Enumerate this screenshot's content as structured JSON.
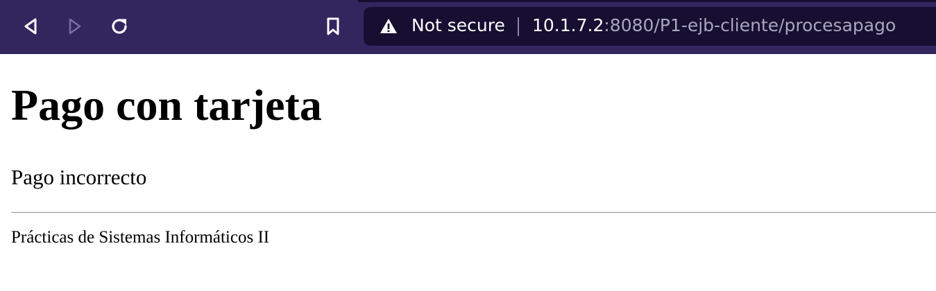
{
  "toolbar": {
    "back_icon": "back-arrow-icon",
    "forward_icon": "forward-arrow-icon",
    "reload_icon": "reload-icon",
    "bookmark_icon": "bookmark-icon",
    "background_color": "#33255e"
  },
  "omnibox": {
    "security_icon": "warning-triangle-icon",
    "security_label": "Not secure",
    "url_host": "10.1.7.2",
    "url_rest": ":8080/P1-ejb-cliente/procesapago",
    "background_color": "#160f32"
  },
  "page": {
    "title": "Pago con tarjeta",
    "status": "Pago incorrecto",
    "footer": "Prácticas de Sistemas Informáticos II"
  }
}
